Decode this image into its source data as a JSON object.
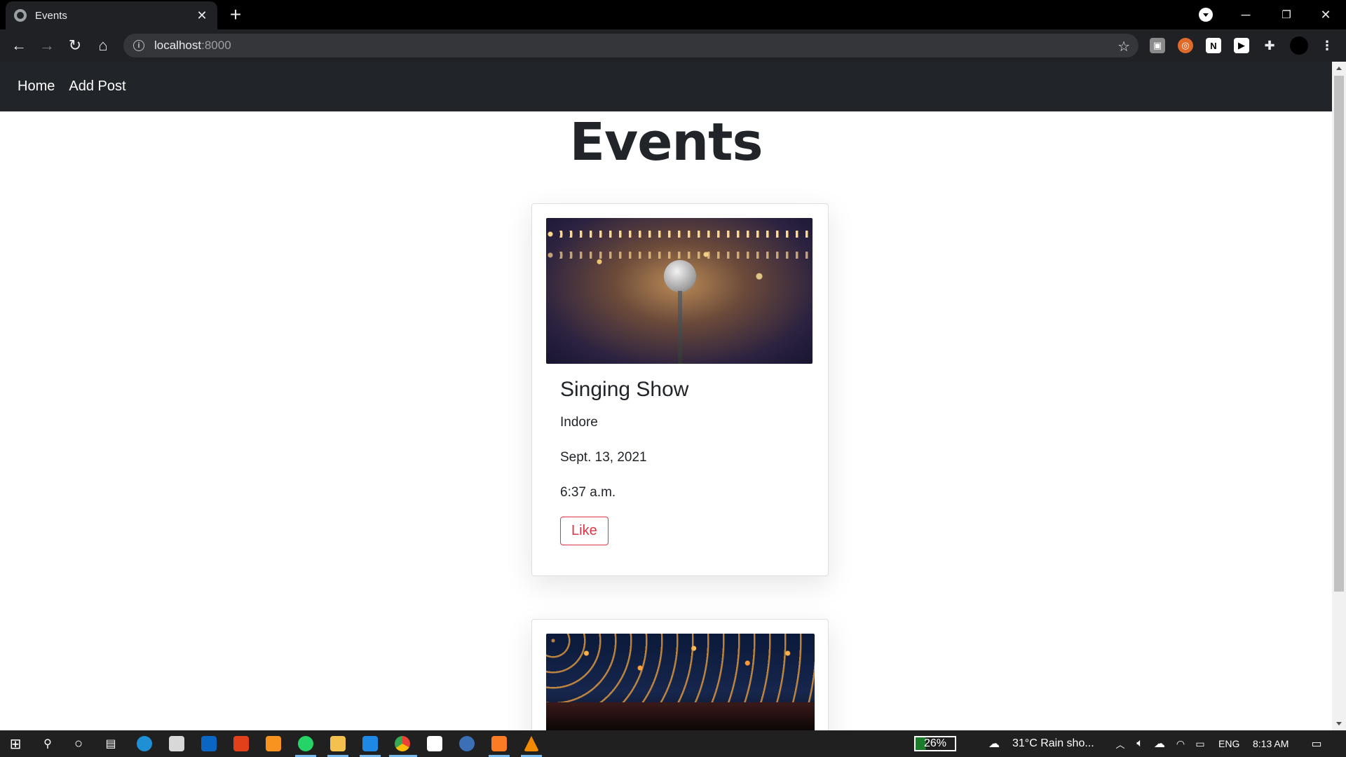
{
  "browser": {
    "tab_title": "Events",
    "tab_close": "✕",
    "new_tab": "+",
    "url_host": "localhost",
    "url_port": ":8000"
  },
  "navbar": {
    "links": [
      "Home",
      "Add Post"
    ]
  },
  "page": {
    "heading": "Events"
  },
  "events": [
    {
      "title": "Singing Show",
      "location": "Indore",
      "date": "Sept. 13, 2021",
      "time": "6:37 a.m.",
      "like_label": "Like",
      "image": "microphone-stage-photo"
    },
    {
      "image": "sky-lanterns-photo"
    }
  ],
  "taskbar": {
    "battery": "26%",
    "weather": "31°C  Rain sho...",
    "language": "ENG",
    "clock": "8:13 AM"
  },
  "colors": {
    "navbar_bg": "#212529",
    "like_red": "#dc3545",
    "browser_bg": "#202124"
  }
}
